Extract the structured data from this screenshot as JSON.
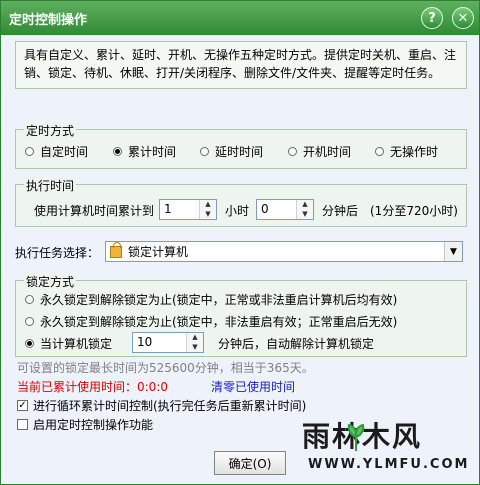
{
  "window": {
    "title": "定时控制操作",
    "help_glyph": "?",
    "close_glyph": "✕"
  },
  "description": "具有自定义、累计、延时、开机、无操作五种定时方式。提供定时关机、重启、注销、锁定、待机、休眠、打开/关闭程序、删除文件/文件夹、提醒等定时任务。",
  "timing_mode": {
    "label": "定时方式",
    "options": [
      "自定时间",
      "累计时间",
      "延时时间",
      "开机时间",
      "无操作时"
    ],
    "selected": "累计时间"
  },
  "exec_time": {
    "label": "执行时间",
    "prefix": "使用计算机时间累计到",
    "hours_value": "1",
    "hours_unit": "小时",
    "minutes_value": "0",
    "minutes_unit": "分钟后",
    "range_note": "(1分至720小时)"
  },
  "task": {
    "label": "执行任务选择：",
    "selected": "锁定计算机"
  },
  "lock_mode": {
    "label": "锁定方式",
    "opt1": "永久锁定到解除锁定为止(锁定中，正常或非法重启计算机后均有效)",
    "opt2": "永久锁定到解除锁定为止(锁定中，非法重启有效；正常重启后无效)",
    "opt3_prefix": "当计算机锁定",
    "opt3_value": "10",
    "opt3_suffix": "分钟后，自动解除计算机锁定",
    "selected": 3
  },
  "hint": "可设置的锁定最长时间为525600分钟，相当于365天。",
  "elapsed": "当前已累计使用时间：0:0:0",
  "reset_link": "清零已使用时间",
  "options": {
    "loop_label": "进行循环累计时间控制(执行完任务后重新累计时间)",
    "loop_checked": true,
    "enable_label": "启用定时控制操作功能",
    "enable_checked": false
  },
  "ok_button": "确定(O)",
  "watermark": {
    "brand": "雨林木风",
    "site": "WWW.YLMFU.COM"
  },
  "colors": {
    "titlebar": "#3a9a3f",
    "elapsed_text": "#e00000",
    "link_text": "#1a1acc",
    "hint_text": "#808080"
  }
}
